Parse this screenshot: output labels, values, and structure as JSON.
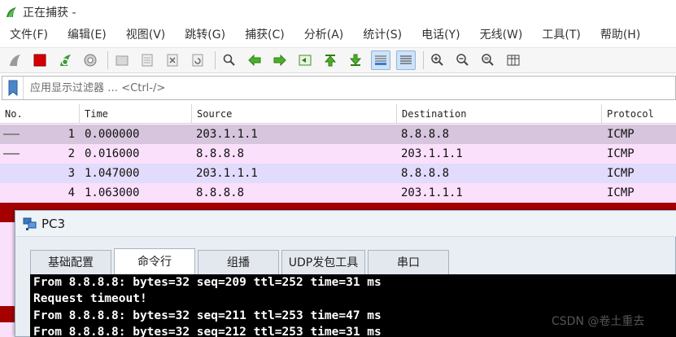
{
  "window": {
    "title": "正在捕获 -"
  },
  "menubar": {
    "items": [
      {
        "label": "文件(F)"
      },
      {
        "label": "编辑(E)"
      },
      {
        "label": "视图(V)"
      },
      {
        "label": "跳转(G)"
      },
      {
        "label": "捕获(C)"
      },
      {
        "label": "分析(A)"
      },
      {
        "label": "统计(S)"
      },
      {
        "label": "电话(Y)"
      },
      {
        "label": "无线(W)"
      },
      {
        "label": "工具(T)"
      },
      {
        "label": "帮助(H)"
      }
    ]
  },
  "toolbar": {
    "icons": [
      "start-capture-icon",
      "stop-capture-icon",
      "restart-capture-icon",
      "capture-options-icon",
      "open-file-icon",
      "save-file-icon",
      "close-file-icon",
      "reload-file-icon",
      "find-packet-icon",
      "go-back-icon",
      "go-forward-icon",
      "go-to-packet-icon",
      "go-first-icon",
      "go-last-icon",
      "autoscroll-icon",
      "colorize-icon",
      "zoom-in-icon",
      "zoom-out-icon",
      "zoom-reset-icon",
      "resize-columns-icon"
    ]
  },
  "filter": {
    "placeholder": "应用显示过滤器 … <Ctrl-/>"
  },
  "packet_list": {
    "columns": [
      "No.",
      "Time",
      "Source",
      "Destination",
      "Protocol"
    ],
    "rows": [
      {
        "no": "1",
        "time": "0.000000",
        "source": "203.1.1.1",
        "destination": "8.8.8.8",
        "protocol": "ICMP",
        "bg": "#d6c5dc",
        "arrow": "request"
      },
      {
        "no": "2",
        "time": "0.016000",
        "source": "8.8.8.8",
        "destination": "203.1.1.1",
        "protocol": "ICMP",
        "bg": "#fbe0fb",
        "arrow": "reply"
      },
      {
        "no": "3",
        "time": "1.047000",
        "source": "203.1.1.1",
        "destination": "8.8.8.8",
        "protocol": "ICMP",
        "bg": "#e1dcfb",
        "arrow": ""
      },
      {
        "no": "4",
        "time": "1.063000",
        "source": "8.8.8.8",
        "destination": "203.1.1.1",
        "protocol": "ICMP",
        "bg": "#fbe0fb",
        "arrow": ""
      }
    ],
    "colors": {
      "partial_row": "#a40000",
      "pink_row": "#fbe0fb"
    }
  },
  "pc3": {
    "title": "PC3",
    "tabs": [
      {
        "label": "基础配置"
      },
      {
        "label": "命令行",
        "active": true
      },
      {
        "label": "组播"
      },
      {
        "label": "UDP发包工具"
      },
      {
        "label": "串口"
      }
    ],
    "console_lines": [
      "From 8.8.8.8: bytes=32 seq=209 ttl=252 time=31 ms",
      "Request timeout!",
      "From 8.8.8.8: bytes=32 seq=211 ttl=253 time=47 ms",
      "From 8.8.8.8: bytes=32 seq=212 ttl=253 time=31 ms"
    ]
  },
  "watermark": {
    "text": "CSDN @卷土重去"
  }
}
